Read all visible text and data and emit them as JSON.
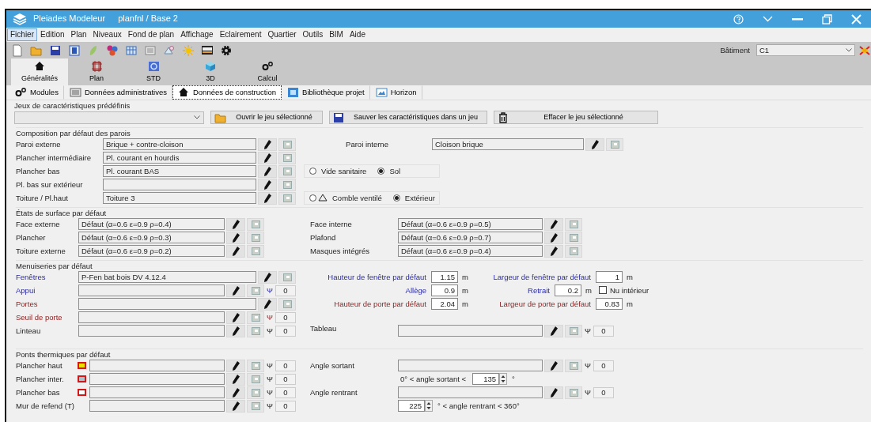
{
  "window": {
    "app": "Pleiades Modeleur",
    "document": "planfnl / Base 2"
  },
  "menu": [
    {
      "label": "Fichier",
      "selected": true
    },
    {
      "label": "Edition",
      "selected": false
    },
    {
      "label": "Plan",
      "selected": false
    },
    {
      "label": "Niveaux",
      "selected": false
    },
    {
      "label": "Fond de plan",
      "selected": false
    },
    {
      "label": "Affichage",
      "selected": false
    },
    {
      "label": "Eclairement",
      "selected": false
    },
    {
      "label": "Quartier",
      "selected": false
    },
    {
      "label": "Outils",
      "selected": false
    },
    {
      "label": "BIM",
      "selected": false
    },
    {
      "label": "Aide",
      "selected": false
    }
  ],
  "building": {
    "label": "Bâtiment",
    "value": "C1"
  },
  "main_tabs": [
    {
      "label": "Généralités",
      "selected": true,
      "kind": "house"
    },
    {
      "label": "Plan",
      "selected": false,
      "kind": "plan"
    },
    {
      "label": "STD",
      "selected": false,
      "kind": "std"
    },
    {
      "label": "3D",
      "selected": false,
      "kind": "cube"
    },
    {
      "label": "Calcul",
      "selected": false,
      "kind": "gears"
    }
  ],
  "sub_tabs": [
    {
      "label": "Modules",
      "selected": false,
      "kind": "gears"
    },
    {
      "label": "Données administratives",
      "selected": false,
      "kind": "list"
    },
    {
      "label": "Données de construction",
      "selected": true,
      "kind": "house"
    },
    {
      "label": "Bibliothèque projet",
      "selected": false,
      "kind": "library"
    },
    {
      "label": "Horizon",
      "selected": false,
      "kind": "horizon"
    }
  ],
  "presets": {
    "title": "Jeux de caractéristiques prédéfinis",
    "buttons": [
      {
        "label": "Ouvrir le jeu sélectionné",
        "kind": "open"
      },
      {
        "label": "Sauver les caractéristiques dans un jeu",
        "kind": "save"
      },
      {
        "label": "Effacer le jeu sélectionné",
        "kind": "delete"
      }
    ]
  },
  "walls": {
    "title": "Composition par défaut des parois",
    "rows": [
      {
        "label": "Paroi externe",
        "value": "Brique + contre-cloison",
        "side": {
          "kind": "field",
          "label": "Paroi interne",
          "value": "Cloison brique"
        }
      },
      {
        "label": "Plancher intermédiaire",
        "value": "Pl. courant en hourdis"
      },
      {
        "label": "Plancher bas",
        "value": "Pl. courant BAS",
        "side": {
          "kind": "radios",
          "options": [
            {
              "label": "Vide sanitaire",
              "selected": false
            },
            {
              "label": "Sol",
              "selected": true
            }
          ]
        }
      },
      {
        "label": "Pl. bas sur extérieur"
      },
      {
        "label": "Toiture / Pl.haut",
        "value": "Toiture 3",
        "side": {
          "kind": "radios",
          "options": [
            {
              "label": "Comble ventilé",
              "selected": false,
              "kind": "attic"
            },
            {
              "label": "Extérieur",
              "selected": true
            }
          ]
        }
      }
    ]
  },
  "surfaces": {
    "title": "États de surface par défaut",
    "rows": [
      {
        "left": {
          "label": "Face externe",
          "value": "Défaut (α=0.6 ε=0.9 ρ=0.4)"
        },
        "right": {
          "label": "Face interne",
          "value": "Défaut (α=0.6 ε=0.9 ρ=0.5)"
        }
      },
      {
        "left": {
          "label": "Plancher",
          "value": "Défaut (α=0.6 ε=0.9 ρ=0.3)"
        },
        "right": {
          "label": "Plafond",
          "value": "Défaut (α=0.6 ε=0.9 ρ=0.7)"
        }
      },
      {
        "left": {
          "label": "Toiture externe",
          "value": "Défaut (α=0.6 ε=0.9 ρ=0.2)"
        },
        "right": {
          "label": "Masques intégrés",
          "value": "Défaut (α=0.6 ε=0.9 ρ=0.4)"
        }
      }
    ]
  },
  "joinery": {
    "title": "Menuiseries par défaut",
    "rows": [
      {
        "label": "Fenêtres",
        "kind": "window",
        "value": "P-Fen bat bois DV 4.12.4",
        "dims": [
          {
            "label": "Hauteur de fenêtre par défaut",
            "kind": "window",
            "value": "1.15",
            "unit": "m"
          },
          {
            "label": "Largeur de fenêtre par défaut",
            "kind": "window",
            "value": "1",
            "unit": "m"
          }
        ]
      },
      {
        "label": "Appui",
        "kind": "window",
        "psi_symbol": "Ψ",
        "psi": "0",
        "dims": [
          {
            "label": "Allège",
            "kind": "window",
            "value": "0.9",
            "unit": "m"
          },
          {
            "label": "Retrait",
            "kind": "window",
            "value": "0.2",
            "unit": "m"
          }
        ],
        "checkbox": {
          "label": "Nu intérieur",
          "checked": false
        }
      },
      {
        "label": "Portes",
        "kind": "door",
        "dims": [
          {
            "label": "Hauteur de porte par défaut",
            "kind": "door",
            "value": "2.04",
            "unit": "m"
          },
          {
            "label": "Largeur de porte par défaut",
            "kind": "door",
            "value": "0.83",
            "unit": "m"
          }
        ]
      },
      {
        "label": "Seuil de porte",
        "kind": "door",
        "psi_symbol": "Ψ",
        "psi": "0"
      },
      {
        "label": "Linteau",
        "kind": "plain",
        "psi_symbol": "Ψ",
        "psi": "0",
        "side": {
          "kind": "field",
          "label": "Tableau",
          "psi_symbol": "Ψ",
          "psi": "0"
        }
      }
    ]
  },
  "thermal_bridges": {
    "title": "Ponts thermiques par défaut",
    "rows": [
      {
        "label": "Plancher haut",
        "color": "#f2dc00",
        "psi_symbol": "Ψ",
        "psi": "0",
        "side": {
          "kind": "field",
          "label": "Angle sortant",
          "psi_symbol": "Ψ",
          "psi": "0"
        }
      },
      {
        "label": "Plancher inter.",
        "color": "#a9c2cc",
        "psi_symbol": "Ψ",
        "psi": "0",
        "side": {
          "kind": "range",
          "before": "0° < angle sortant <",
          "value": "135",
          "after": "°"
        }
      },
      {
        "label": "Plancher bas",
        "color": "#ffffff",
        "psi_symbol": "Ψ",
        "psi": "0",
        "side": {
          "kind": "field",
          "label": "Angle rentrant",
          "psi_symbol": "Ψ",
          "psi": "0"
        }
      },
      {
        "label": "Mur de refend (T)",
        "psi_symbol": "Ψ",
        "psi": "0",
        "side": {
          "kind": "range",
          "value": "225",
          "after": "° < angle rentrant < 360°"
        }
      }
    ]
  }
}
